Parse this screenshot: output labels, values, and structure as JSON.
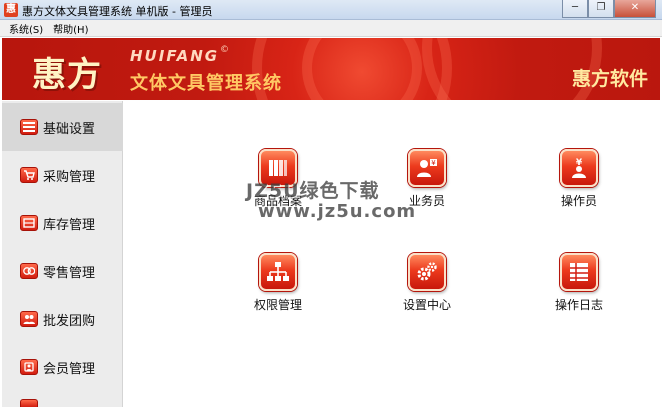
{
  "window": {
    "title": "惠方文体文具管理系统 单机版 - 管理员",
    "app_icon": "惠",
    "minimize": "─",
    "restore": "❐",
    "close": "✕"
  },
  "menu": {
    "items": [
      {
        "label": "系统(S)"
      },
      {
        "label": "帮助(H)"
      }
    ]
  },
  "banner": {
    "brand_big": "惠方",
    "brand_en": "HUIFANG",
    "brand_reg": "©",
    "brand_cn": "文体文具管理系统",
    "brand_right": "惠方软件"
  },
  "sidebar": {
    "items": [
      {
        "label": "基础设置",
        "icon": "settings-grid-icon",
        "active": true
      },
      {
        "label": "采购管理",
        "icon": "purchase-icon"
      },
      {
        "label": "库存管理",
        "icon": "inventory-icon"
      },
      {
        "label": "零售管理",
        "icon": "retail-icon"
      },
      {
        "label": "批发团购",
        "icon": "wholesale-icon"
      },
      {
        "label": "会员管理",
        "icon": "member-icon"
      }
    ]
  },
  "main": {
    "tiles": [
      {
        "label": "商品档案",
        "icon": "product-archive-icon"
      },
      {
        "label": "业务员",
        "icon": "salesperson-icon"
      },
      {
        "label": "操作员",
        "icon": "operator-icon"
      },
      {
        "label": "权限管理",
        "icon": "permission-icon"
      },
      {
        "label": "设置中心",
        "icon": "gear-icon"
      },
      {
        "label": "操作日志",
        "icon": "log-icon"
      }
    ]
  },
  "watermark": {
    "line1": "JZ5U绿色下载",
    "line2": "www.jz5u.com"
  },
  "colors": {
    "brand_red": "#d82416",
    "accent_yellow": "#ffc864"
  }
}
